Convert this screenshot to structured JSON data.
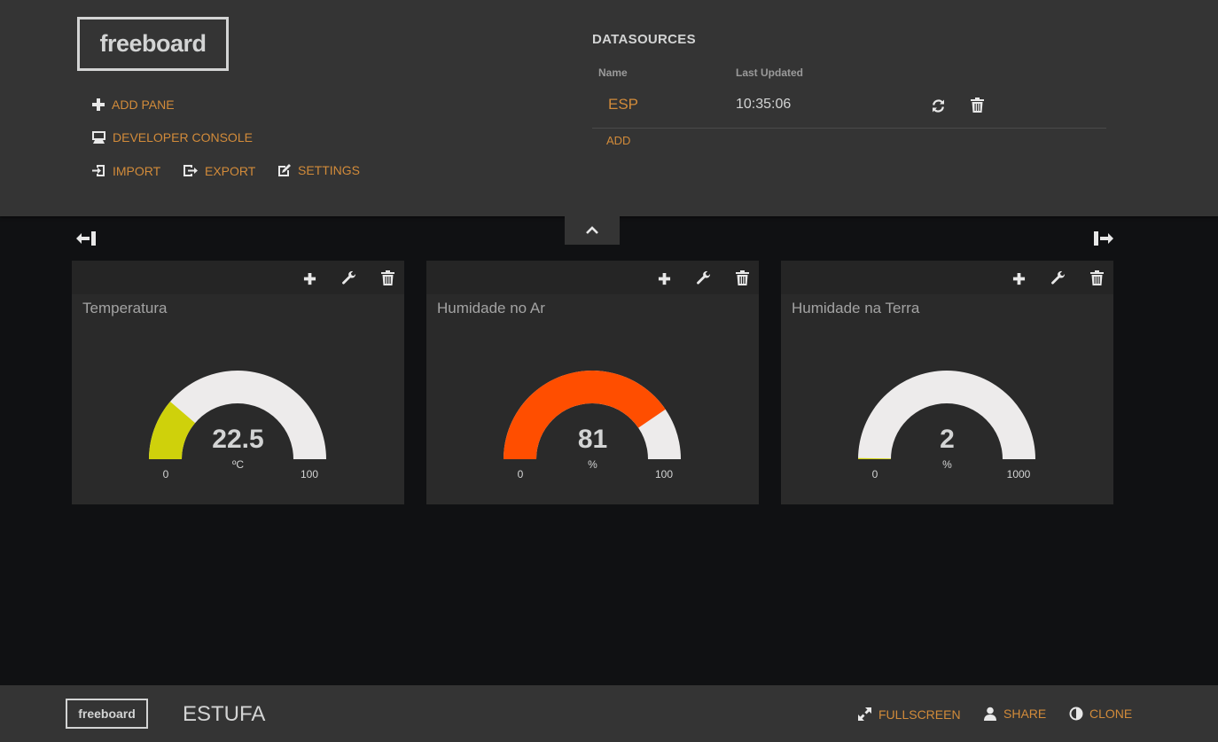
{
  "header": {
    "logo": "freeboard",
    "menu": {
      "add_pane": "ADD PANE",
      "developer_console": "DEVELOPER CONSOLE",
      "import": "IMPORT",
      "export": "EXPORT",
      "settings": "SETTINGS"
    },
    "datasources": {
      "title": "DATASOURCES",
      "col_name": "Name",
      "col_updated": "Last Updated",
      "rows": [
        {
          "name": "ESP",
          "last_updated": "10:35:06"
        }
      ],
      "add": "ADD"
    }
  },
  "panes": [
    {
      "title": "Temperatura",
      "value": "22.5",
      "unit": "ºC",
      "min": "0",
      "max": "100",
      "fill_fraction": 0.225,
      "color": "#cfd10b"
    },
    {
      "title": "Humidade no Ar",
      "value": "81",
      "unit": "%",
      "min": "0",
      "max": "100",
      "fill_fraction": 0.81,
      "color": "#ff4e00"
    },
    {
      "title": "Humidade na Terra",
      "value": "2",
      "unit": "%",
      "min": "0",
      "max": "1000",
      "fill_fraction": 0.002,
      "color": "#cfd10b"
    }
  ],
  "footer": {
    "logo": "freeboard",
    "title": "ESTUFA",
    "fullscreen": "FULLSCREEN",
    "share": "SHARE",
    "clone": "CLONE"
  },
  "colors": {
    "accent": "#d28b3a",
    "gauge_track": "#edebeb",
    "header_bg": "#343434",
    "page_bg": "#101113",
    "pane_bg": "#2a2a2a"
  },
  "icons": [
    "plus-icon",
    "monitor-icon",
    "import-icon",
    "export-icon",
    "edit-icon",
    "refresh-icon",
    "trash-icon",
    "chevron-up-icon",
    "shrink-left-icon",
    "expand-right-icon",
    "wrench-icon",
    "fullscreen-icon",
    "user-icon",
    "contrast-icon"
  ]
}
